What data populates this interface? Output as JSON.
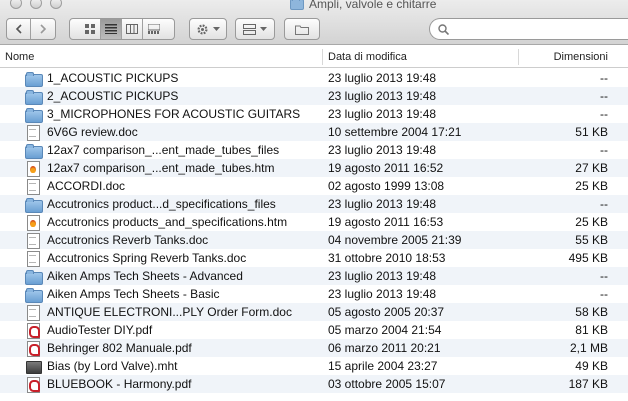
{
  "window": {
    "title": "Ampli, valvole e chitarre"
  },
  "search": {
    "placeholder": "",
    "value": ""
  },
  "columns": {
    "name": "Nome",
    "date": "Data di modifica",
    "size": "Dimensioni"
  },
  "files": [
    {
      "name": "1_ACOUSTIC PICKUPS",
      "date": "23 luglio 2013 19:48",
      "size": "--",
      "type": "folder"
    },
    {
      "name": "2_ACOUSTIC PICKUPS",
      "date": "23 luglio 2013 19:48",
      "size": "--",
      "type": "folder"
    },
    {
      "name": "3_MICROPHONES FOR ACOUSTIC GUITARS",
      "date": "23 luglio 2013 19:48",
      "size": "--",
      "type": "folder"
    },
    {
      "name": "6V6G review.doc",
      "date": "10 settembre 2004 17:21",
      "size": "51 KB",
      "type": "doc"
    },
    {
      "name": "12ax7 comparison_...ent_made_tubes_files",
      "date": "23 luglio 2013 19:48",
      "size": "--",
      "type": "folder"
    },
    {
      "name": "12ax7 comparison_...ent_made_tubes.htm",
      "date": "19 agosto 2011 16:52",
      "size": "27 KB",
      "type": "htm"
    },
    {
      "name": "ACCORDI.doc",
      "date": "02 agosto 1999 13:08",
      "size": "25 KB",
      "type": "doc"
    },
    {
      "name": "Accutronics product...d_specifications_files",
      "date": "23 luglio 2013 19:48",
      "size": "--",
      "type": "folder"
    },
    {
      "name": "Accutronics products_and_specifications.htm",
      "date": "19 agosto 2011 16:53",
      "size": "25 KB",
      "type": "htm"
    },
    {
      "name": "Accutronics Reverb Tanks.doc",
      "date": "04 novembre 2005 21:39",
      "size": "55 KB",
      "type": "doc"
    },
    {
      "name": "Accutronics Spring Reverb Tanks.doc",
      "date": "31 ottobre 2010 18:53",
      "size": "495 KB",
      "type": "doc"
    },
    {
      "name": "Aiken Amps Tech Sheets - Advanced",
      "date": "23 luglio 2013 19:48",
      "size": "--",
      "type": "folder"
    },
    {
      "name": "Aiken Amps Tech Sheets - Basic",
      "date": "23 luglio 2013 19:48",
      "size": "--",
      "type": "folder"
    },
    {
      "name": "ANTIQUE ELECTRONI...PLY Order Form.doc",
      "date": "05 agosto 2005 20:37",
      "size": "58 KB",
      "type": "doc"
    },
    {
      "name": "AudioTester DIY.pdf",
      "date": "05 marzo 2004 21:54",
      "size": "81 KB",
      "type": "pdf"
    },
    {
      "name": "Behringer 802 Manuale.pdf",
      "date": "06 marzo 2011 20:21",
      "size": "2,1 MB",
      "type": "pdf"
    },
    {
      "name": "Bias (by Lord Valve).mht",
      "date": "15 aprile 2004 23:27",
      "size": "49 KB",
      "type": "mht"
    },
    {
      "name": "BLUEBOOK - Harmony.pdf",
      "date": "03 ottobre 2005 15:07",
      "size": "187 KB",
      "type": "pdf"
    }
  ]
}
